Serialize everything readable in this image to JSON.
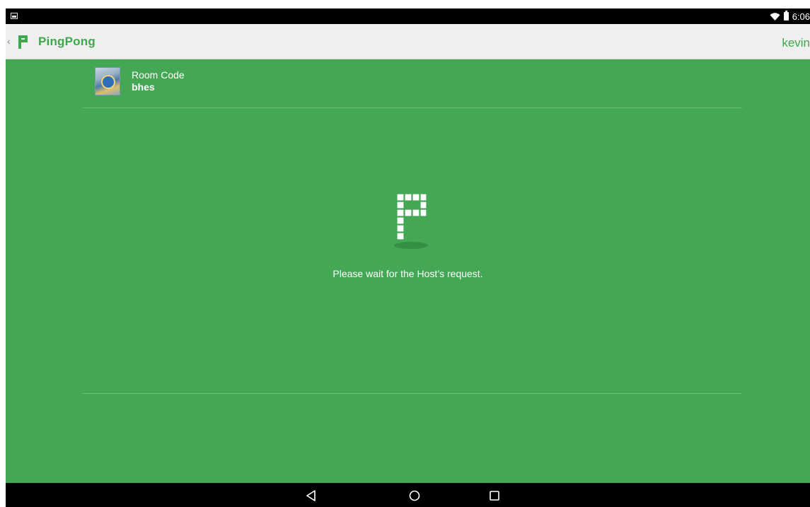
{
  "status_bar": {
    "time": "6:06",
    "icons": [
      "image-notification-icon",
      "wifi-icon",
      "battery-icon"
    ]
  },
  "action_bar": {
    "title": "PingPong",
    "user": "kevin",
    "brand_color": "#3fa74d"
  },
  "room": {
    "label": "Room Code",
    "code": "bhes"
  },
  "main": {
    "message": "Please wait for the Host’s request.",
    "background_color": "#43a754"
  },
  "nav_bar": {
    "buttons": [
      "back-icon",
      "home-icon",
      "recents-icon"
    ]
  }
}
